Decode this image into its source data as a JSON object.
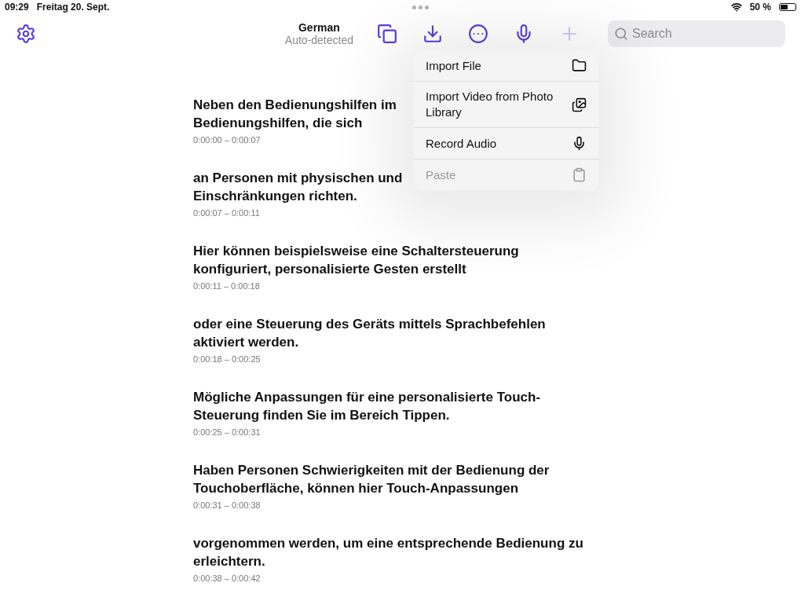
{
  "status_bar": {
    "time": "09:29",
    "date": "Freitag 20. Sept.",
    "battery": "50 %"
  },
  "toolbar": {
    "language": "German",
    "language_hint": "Auto-detected",
    "search": {
      "placeholder": "Search"
    },
    "buttons": [
      {
        "kind": "copy",
        "disabled": false
      },
      {
        "kind": "import",
        "disabled": false
      },
      {
        "kind": "more",
        "disabled": false
      },
      {
        "kind": "mic",
        "disabled": false
      },
      {
        "kind": "add",
        "disabled": true
      }
    ]
  },
  "menu": [
    {
      "label": "Import File",
      "kind": "folder",
      "disabled": false
    },
    {
      "label": "Import Video from Photo Library",
      "kind": "photos",
      "disabled": false
    },
    {
      "label": "Record Audio",
      "kind": "mic",
      "disabled": false
    },
    {
      "label": "Paste",
      "kind": "paste",
      "disabled": true
    }
  ],
  "segments": [
    {
      "lines": [
        "Neben den Bedienungshilfen im",
        "Bedienungshilfen, die sich"
      ],
      "time": "0:00:00 – 0:00:07"
    },
    {
      "lines": [
        "an Personen mit physischen und",
        "Einschränkungen richten."
      ],
      "time": "0:00:07 – 0:00:11"
    },
    {
      "lines": [
        "Hier können beispielsweise eine Schaltersteuerung",
        "konfiguriert, personalisierte Gesten erstellt"
      ],
      "time": "0:00:11 – 0:00:18"
    },
    {
      "lines": [
        "oder eine Steuerung des Geräts mittels Sprachbefehlen",
        "aktiviert werden."
      ],
      "time": "0:00:18 – 0:00:25"
    },
    {
      "lines": [
        "Mögliche Anpassungen für eine personalisierte Touch-",
        "Steuerung  finden Sie im Bereich Tippen."
      ],
      "time": "0:00:25 – 0:00:31"
    },
    {
      "lines": [
        "Haben Personen Schwierigkeiten mit der Bedienung der",
        "Touchoberfläche, können hier Touch-Anpassungen"
      ],
      "time": "0:00:31 – 0:00:38"
    },
    {
      "lines": [
        "vorgenommen werden, um eine entsprechende Bedienung zu",
        "erleichtern."
      ],
      "time": "0:00:38 – 0:00:42"
    }
  ]
}
